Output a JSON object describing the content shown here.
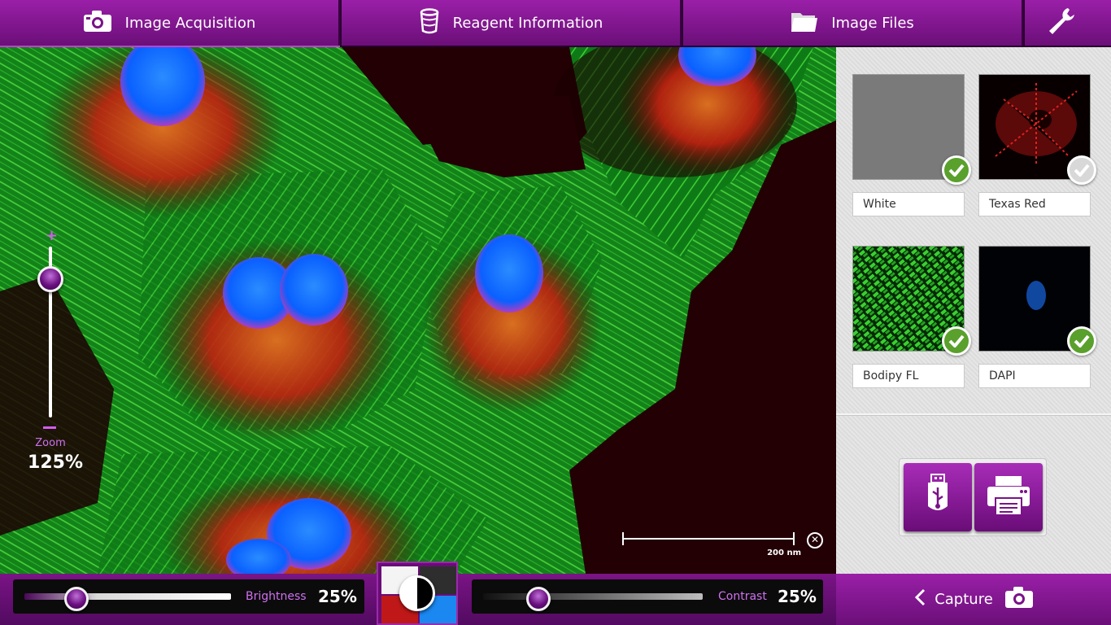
{
  "nav": {
    "tabs": [
      {
        "label": "Image Acquisition",
        "icon": "camera-icon"
      },
      {
        "label": "Reagent Information",
        "icon": "beaker-icon"
      },
      {
        "label": "Image Files",
        "icon": "folder-icon"
      }
    ],
    "settings_icon": "wrench-icon",
    "accent": "#8a169a"
  },
  "viewer": {
    "zoom": {
      "label": "Zoom",
      "value": "125%",
      "plus": "+",
      "level_fraction": 0.13
    },
    "scalebar": {
      "label": "200 nm"
    }
  },
  "channels": [
    {
      "name": "White",
      "selected": true
    },
    {
      "name": "Texas Red",
      "selected": false
    },
    {
      "name": "Bodipy FL",
      "selected": true
    },
    {
      "name": "DAPI",
      "selected": true
    }
  ],
  "export": {
    "usb_icon": "usb-icon",
    "print_icon": "printer-icon"
  },
  "bottom": {
    "brightness": {
      "label": "Brightness",
      "value": "25%",
      "level_fraction": 0.25
    },
    "contrast": {
      "label": "Contrast",
      "value": "25%",
      "level_fraction": 0.25
    },
    "capture": {
      "label": "Capture"
    }
  }
}
